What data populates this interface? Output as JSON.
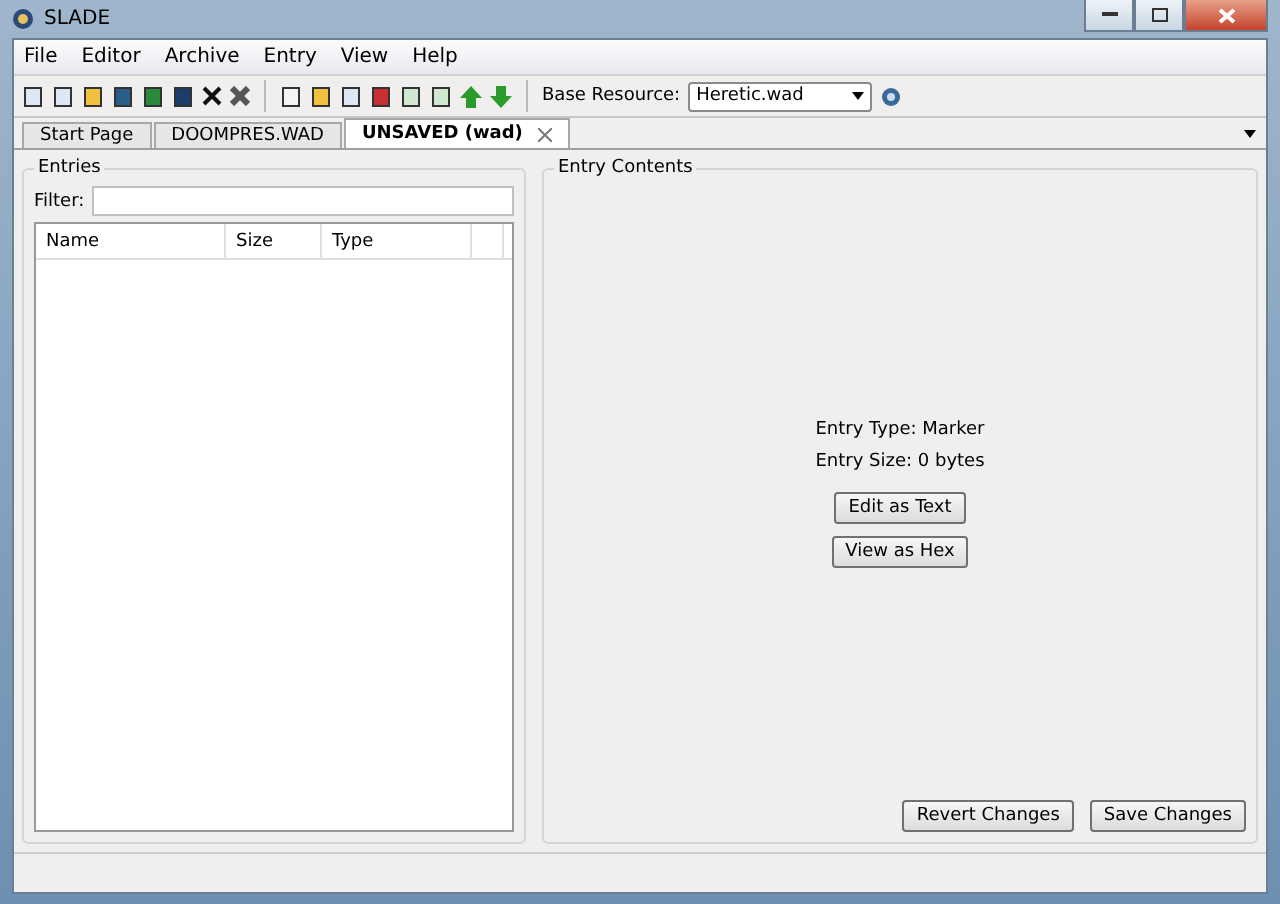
{
  "window": {
    "title": "SLADE"
  },
  "menu": [
    "File",
    "Editor",
    "Archive",
    "Entry",
    "View",
    "Help"
  ],
  "toolbar": {
    "base_resource_label": "Base Resource:",
    "base_resource_value": "Heretic.wad"
  },
  "tabs": [
    {
      "label": "Start Page",
      "selected": false,
      "closable": false
    },
    {
      "label": "DOOMPRES.WAD",
      "selected": false,
      "closable": false
    },
    {
      "label": "UNSAVED (wad)",
      "selected": true,
      "closable": true
    }
  ],
  "entries": {
    "title": "Entries",
    "filter_label": "Filter:",
    "columns": [
      "Name",
      "Size",
      "Type"
    ]
  },
  "contents": {
    "title": "Entry Contents",
    "entry_type": "Entry Type: Marker",
    "entry_size": "Entry Size: 0 bytes",
    "buttons": [
      "Edit as Text",
      "View as Hex"
    ],
    "bottom_buttons": [
      "Revert Changes",
      "Save Changes"
    ]
  }
}
